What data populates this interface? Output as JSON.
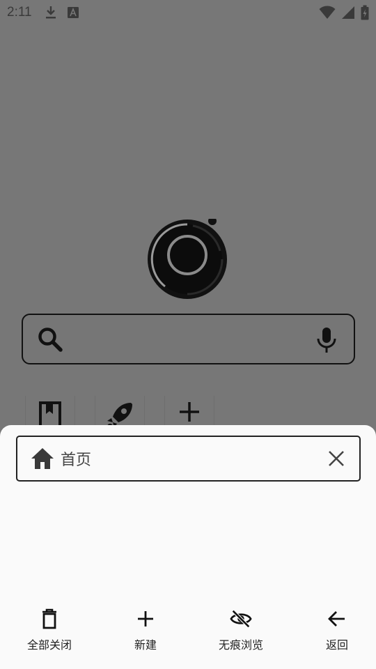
{
  "status_bar": {
    "time": "2:11",
    "left_icons": [
      "download-icon",
      "font-icon"
    ],
    "right_icons": [
      "wifi-icon",
      "signal-icon",
      "battery-icon"
    ]
  },
  "home": {
    "logo": "app-logo",
    "search": {
      "placeholder": "",
      "icons": [
        "search-icon",
        "mic-icon"
      ]
    },
    "shortcuts": [
      "bookmark-icon",
      "rocket-icon",
      "plus-icon"
    ]
  },
  "tab_sheet": {
    "tabs": [
      {
        "title": "首页",
        "icon": "home-icon"
      }
    ],
    "actions": {
      "close_all": "全部关闭",
      "new": "新建",
      "incognito": "无痕浏览",
      "back": "返回"
    }
  },
  "colors": {
    "scrim": "#777777",
    "sheet": "#fafafa",
    "text": "#222222"
  }
}
